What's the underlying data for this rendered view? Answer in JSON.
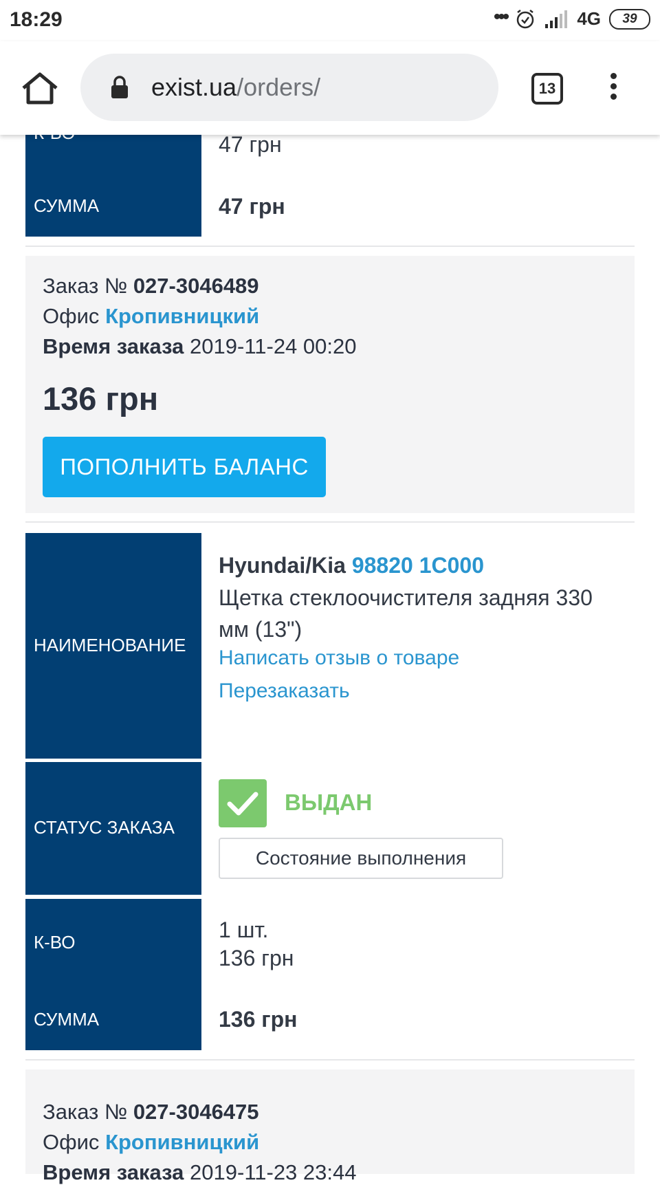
{
  "status_bar": {
    "time": "18:29",
    "dots": "•••",
    "network": "4G",
    "battery": "39"
  },
  "browser": {
    "url_domain": "exist.ua",
    "url_path": "/orders/",
    "tabs_count": "13"
  },
  "prev_order_tail": {
    "qty_label": "К-ВО",
    "price": "47 грн",
    "sum_label": "СУММА",
    "sum": "47 грн"
  },
  "order1": {
    "number_label": "Заказ №",
    "number": "027-3046489",
    "office_label": "Офис",
    "office": "Кропивницкий",
    "time_label": "Время заказа",
    "time": "2019-11-24 00:20",
    "amount": "136 грн",
    "pay_button": "ПОПОЛНИТЬ БАЛАНС",
    "item": {
      "name_label": "НАИМЕНОВАНИЕ",
      "brand": "Hyundai/Kia",
      "article": "98820 1C000",
      "description_line1": "Щетка стеклоочистителя задняя 330",
      "description_line2": "мм (13\")",
      "review_link": "Написать отзыв о товаре",
      "reorder_link": "Перезаказать",
      "status_label": "СТАТУС ЗАКАЗА",
      "status": "ВЫДАН",
      "state_button": "Состояние выполнения",
      "qty_label": "К-ВО",
      "qty": "1 шт.",
      "price": "136 грн",
      "sum_label": "СУММА",
      "sum": "136 грн"
    }
  },
  "order2": {
    "number_label": "Заказ №",
    "number": "027-3046475",
    "office_label": "Офис",
    "office": "Кропивницкий",
    "time_label": "Время заказа",
    "time": "2019-11-23 23:44"
  },
  "colors": {
    "label_bg": "#023f73",
    "link": "#2a95cf",
    "pay_button": "#13a9ec",
    "status_green": "#7cc96e",
    "card_bg": "#f4f4f5"
  }
}
